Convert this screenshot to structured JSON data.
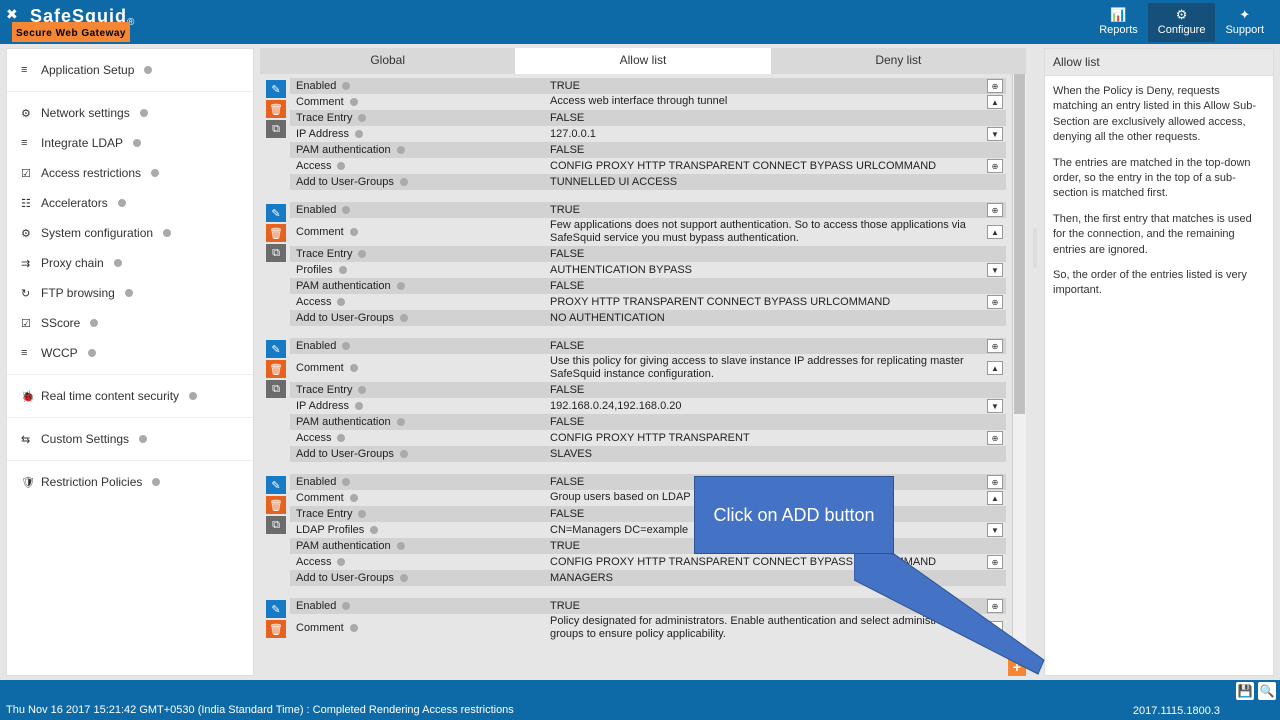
{
  "header": {
    "product": "SafeSquid",
    "reg": "®",
    "tagline": "Secure Web Gateway",
    "nav": {
      "reports": "Reports",
      "configure": "Configure",
      "support": "Support"
    }
  },
  "sidebar": {
    "group1": [
      {
        "icon": "≡",
        "label": "Application Setup"
      }
    ],
    "group2": [
      {
        "icon": "⚙",
        "label": "Network settings"
      },
      {
        "icon": "≡",
        "label": "Integrate LDAP"
      },
      {
        "icon": "☑",
        "label": "Access restrictions"
      },
      {
        "icon": "☷",
        "label": "Accelerators"
      },
      {
        "icon": "⚙",
        "label": "System configuration"
      },
      {
        "icon": "⇉",
        "label": "Proxy chain"
      },
      {
        "icon": "↻",
        "label": "FTP browsing"
      },
      {
        "icon": "☑",
        "label": "SScore"
      },
      {
        "icon": "≡",
        "label": "WCCP"
      }
    ],
    "group3": [
      {
        "icon": "🐞",
        "label": "Real time content security"
      }
    ],
    "group4": [
      {
        "icon": "⇆",
        "label": "Custom Settings"
      }
    ],
    "group5": [
      {
        "icon": "🛡",
        "label": "Restriction Policies"
      }
    ]
  },
  "tabs": {
    "global": "Global",
    "allow": "Allow list",
    "deny": "Deny list"
  },
  "labels": {
    "enabled": "Enabled",
    "comment": "Comment",
    "trace": "Trace Entry",
    "ip": "IP Address",
    "pam": "PAM authentication",
    "access": "Access",
    "addug": "Add to User-Groups",
    "profiles": "Profiles",
    "ldapp": "LDAP Profiles"
  },
  "entries": [
    {
      "enabled": "TRUE",
      "comment": "Access web interface through tunnel",
      "trace": "FALSE",
      "extraLabel": "ip",
      "extraValue": "127.0.0.1",
      "pam": "FALSE",
      "access": "CONFIG  PROXY  HTTP  TRANSPARENT  CONNECT  BYPASS  URLCOMMAND",
      "addug": "TUNNELLED UI ACCESS"
    },
    {
      "enabled": "TRUE",
      "comment": "Few applications does not support authentication. So to access those applications via SafeSquid service you must bypass authentication.",
      "trace": "FALSE",
      "extraLabel": "profiles",
      "extraValue": "AUTHENTICATION BYPASS",
      "pam": "FALSE",
      "access": "PROXY  HTTP  TRANSPARENT  CONNECT  BYPASS  URLCOMMAND",
      "addug": "NO AUTHENTICATION"
    },
    {
      "enabled": "FALSE",
      "comment": "Use this policy for giving access to slave instance IP addresses for replicating master SafeSquid instance configuration.",
      "trace": "FALSE",
      "extraLabel": "ip",
      "extraValue": "192.168.0.24,192.168.0.20",
      "pam": "FALSE",
      "access": "CONFIG  PROXY  HTTP  TRANSPARENT",
      "addug": "SLAVES"
    },
    {
      "enabled": "FALSE",
      "comment": "Group users based on LDAP",
      "trace": "FALSE",
      "extraLabel": "ldapp",
      "extraValue": "CN=Managers DC=example",
      "pam": "TRUE",
      "access": "CONFIG  PROXY  HTTP  TRANSPARENT  CONNECT  BYPASS  URLCOMMAND",
      "addug": "MANAGERS"
    },
    {
      "enabled": "TRUE",
      "comment": "Policy designated for administrators. Enable authentication and select administrative groups to ensure policy applicability."
    }
  ],
  "rpanel": {
    "title": "Allow list",
    "p1": "When the Policy is Deny, requests matching an entry listed in this Allow Sub-Section are exclusively allowed access, denying all the other requests.",
    "p2": "The entries are matched in the top-down order, so the entry in the top of a sub-section is matched first.",
    "p3": "Then, the first entry that matches is used for the connection, and the remaining entries are ignored.",
    "p4": "So, the order of the entries listed is very important."
  },
  "callout": "Click on ADD button",
  "footer": {
    "status": "Thu Nov 16 2017 15:21:42 GMT+0530 (India Standard Time) : Completed Rendering Access restrictions",
    "version": "2017.1115.1800.3"
  }
}
